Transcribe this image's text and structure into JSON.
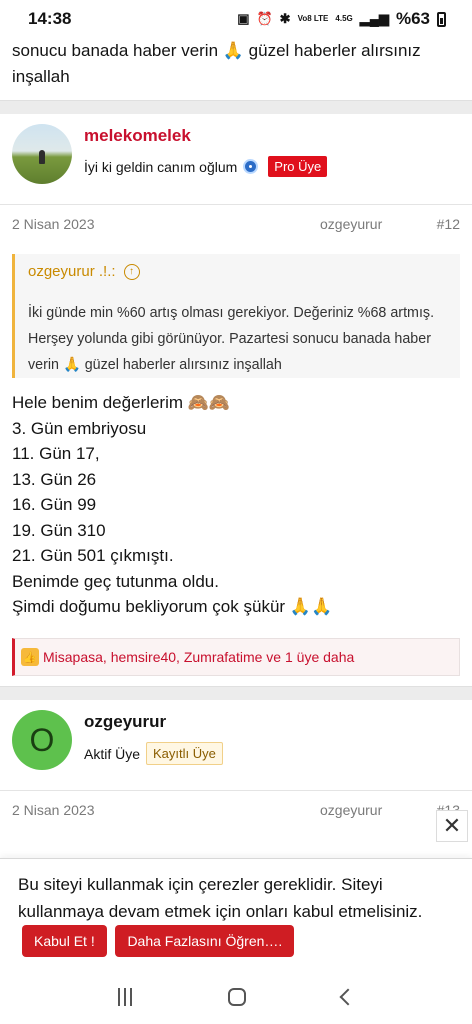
{
  "status_bar": {
    "time": "14:38",
    "network": "Vo8 LTE",
    "signal": "4.5G",
    "battery_percent": "%63"
  },
  "prev_post_tail": {
    "text": "sonucu banada haber verin 🙏 güzel haberler alırsınız inşallah"
  },
  "post12": {
    "user": {
      "name": "melekomelek",
      "subtitle": "İyi ki geldin canım oğlum",
      "badge": "Pro Üye"
    },
    "date": "2 Nisan 2023",
    "author": "ozgeyurur",
    "number": "#12",
    "quote": {
      "author": "ozgeyurur .!.:",
      "text": "İki günde min %60 artış olması gerekiyor. Değeriniz %68 artmış. Herşey yolunda gibi görünüyor. Pazartesi sonucu banada haber verin 🙏 güzel haberler alırsınız inşallah"
    },
    "body": [
      "Hele benim değerlerim 🙈🙈",
      "3. Gün embriyosu",
      "11. Gün 17,",
      "13. Gün 26",
      "16. Gün 99",
      "19. Gün 310",
      "21. Gün 501 çıkmıştı.",
      "Benimde geç tutunma oldu.",
      "Şimdi doğumu bekliyorum çok şükür 🙏🙏"
    ],
    "reactions": "Misapasa, hemsire40, Zumrafatime ve 1 üye daha"
  },
  "post13": {
    "user": {
      "name": "ozgeyurur",
      "avatar_letter": "O",
      "subtitle": "Aktif Üye",
      "badge": "Kayıtlı Üye"
    },
    "date": "2 Nisan 2023",
    "author": "ozgeyurur",
    "number": "#13"
  },
  "cookie": {
    "text": "Bu siteyi kullanmak için çerezler gereklidir. Siteyi kullanmaya devam etmek için onları kabul etmelisiniz.",
    "accept_label": "Kabul Et !",
    "learn_more_label": "Daha Fazlasını Öğren…."
  },
  "colors": {
    "accent_red": "#c8102e",
    "quote_accent": "#f0b43d",
    "avatar_green": "#5ec14d"
  }
}
